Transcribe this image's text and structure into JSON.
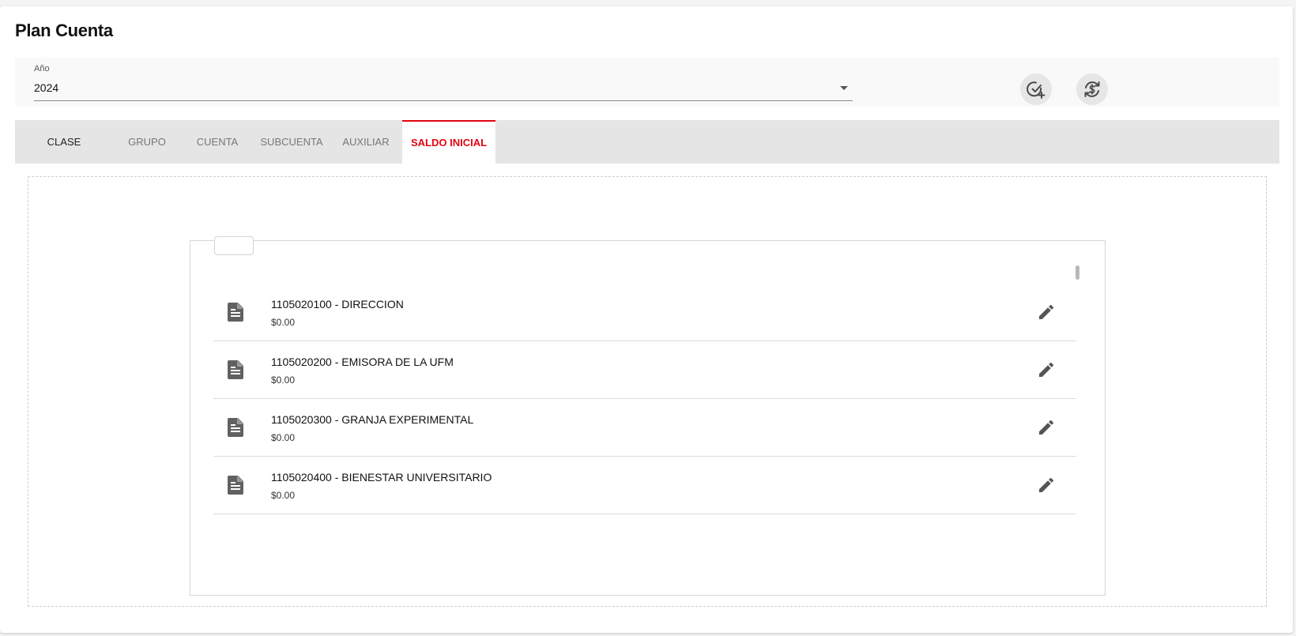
{
  "page": {
    "title": "Plan Cuenta"
  },
  "filters": {
    "year_label": "Año",
    "year_value": "2024",
    "actions": [
      {
        "icon": "check-circle-plus-icon"
      },
      {
        "icon": "currency-sync-icon"
      }
    ]
  },
  "tabs": [
    {
      "label": "CLASE"
    },
    {
      "label": "GRUPO"
    },
    {
      "label": "CUENTA"
    },
    {
      "label": "SUBCUENTA"
    },
    {
      "label": "AUXILIAR"
    },
    {
      "label": "SALDO INICIAL",
      "active": true
    }
  ],
  "accounts": [
    {
      "title": "1105020100 - DIRECCION",
      "balance": "$0.00",
      "icon": "document-icon",
      "action_icon": "pencil-icon"
    },
    {
      "title": "1105020200 - EMISORA DE LA UFM",
      "balance": "$0.00",
      "icon": "document-icon",
      "action_icon": "pencil-icon"
    },
    {
      "title": "1105020300 - GRANJA EXPERIMENTAL",
      "balance": "$0.00",
      "icon": "document-icon",
      "action_icon": "pencil-icon"
    },
    {
      "title": "1105020400 - BIENESTAR UNIVERSITARIO",
      "balance": "$0.00",
      "icon": "document-icon",
      "action_icon": "pencil-icon"
    }
  ],
  "colors": {
    "accent": "#e30613",
    "tab_bar": "#e5e5e5",
    "icon": "#616161"
  }
}
